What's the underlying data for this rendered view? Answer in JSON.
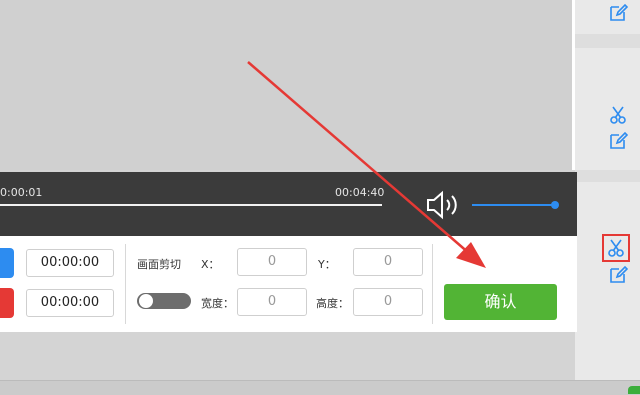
{
  "player": {
    "current_time": "0:00:01",
    "total_time": "00:04:40"
  },
  "clip": {
    "start_time": "00:00:00",
    "end_time": "00:00:00"
  },
  "crop": {
    "label": "画面剪切",
    "x_label": "X：",
    "y_label": "Y：",
    "width_label": "宽度：",
    "height_label": "高度：",
    "x_value": "0",
    "y_value": "0",
    "width_value": "0",
    "height_value": "0"
  },
  "confirm_label": "确认",
  "colors": {
    "accent_blue": "#2d8cf0",
    "red": "#e53935",
    "green": "#52b435"
  },
  "icons": [
    "edit-icon",
    "scissors-icon",
    "volume-icon"
  ]
}
